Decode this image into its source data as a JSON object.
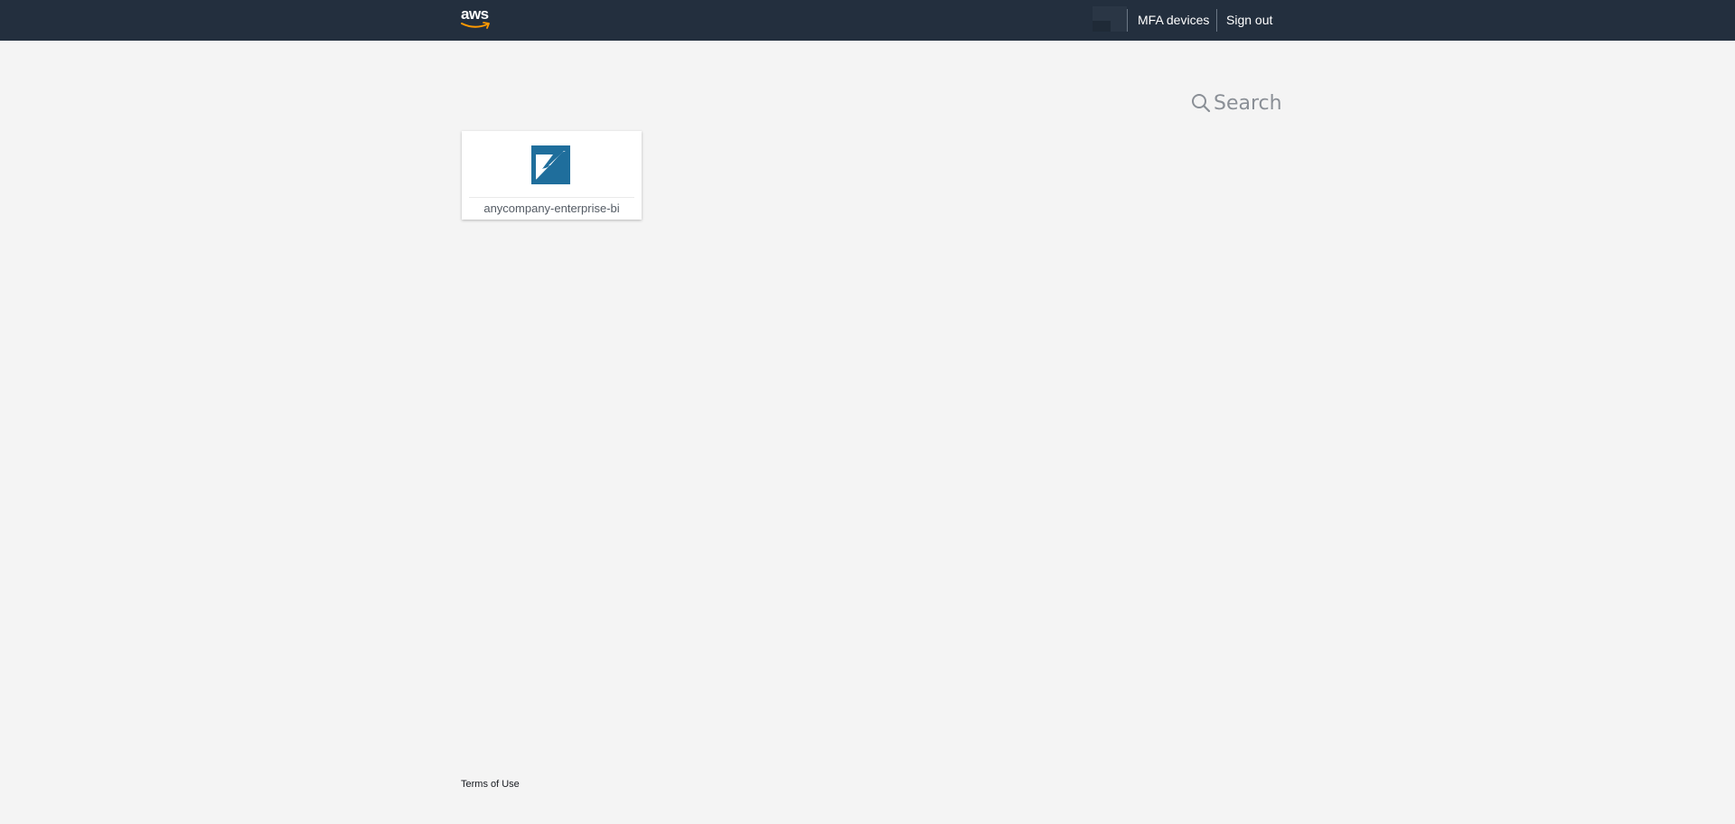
{
  "header": {
    "logo_text": "aws",
    "mfa_label": "MFA devices",
    "signout_label": "Sign out",
    "background_color": "#232f3e",
    "logo_smile_color": "#ff9900"
  },
  "search": {
    "placeholder": "Search",
    "icon": "search-icon"
  },
  "apps": [
    {
      "label": "anycompany-enterprise-bi",
      "icon": "quicksight-icon",
      "icon_color": "#1f6e9c"
    }
  ],
  "footer": {
    "terms_label": "Terms of Use"
  }
}
